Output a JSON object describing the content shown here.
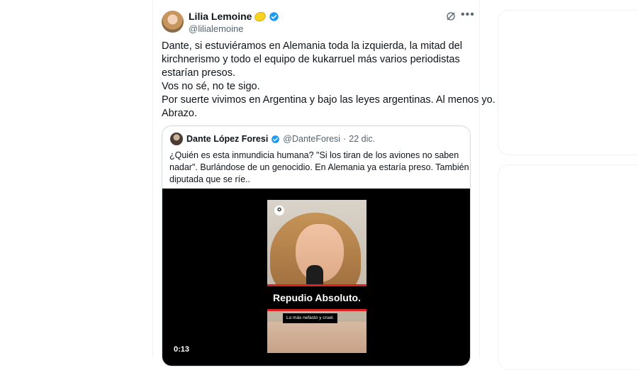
{
  "author": {
    "name": "Lilia Lemoine",
    "handle": "@lilialemoine"
  },
  "tweet": {
    "lines": [
      "Dante, si estuviéramos en Alemania toda la izquierda, la mitad del",
      "kirchnerismo y todo el equipo de kukarruel más varios periodistas",
      "estarían presos.",
      "Vos no sé, no te sigo.",
      "Por suerte vivimos en Argentina y bajo las leyes argentinas. Al menos yo.",
      "Abrazo."
    ]
  },
  "quote": {
    "name": "Dante López Foresi",
    "handle": "@DanteForesi",
    "separator": "·",
    "date": "22 dic.",
    "lines": [
      "¿Quién es esta inmundicia humana? \"Si los tiran de los aviones no saben",
      "nadar\". Burlándose de un genocidio. En Alemania ya estaría preso. También la",
      "diputada que se ríe.."
    ]
  },
  "video": {
    "banner": "Repudio Absoluto.",
    "subbanner": "Lo más nefasto y cruel.",
    "time": "0:13"
  },
  "icons": {
    "verified": "verified-badge-icon",
    "lemon": "lemon-emoji-icon",
    "grok": "grok-icon",
    "more": "more-options-icon"
  },
  "colors": {
    "verified": "#1d9bf0",
    "secondary_text": "#536471",
    "border": "#cfd9de",
    "banner_red": "#dd2222"
  }
}
